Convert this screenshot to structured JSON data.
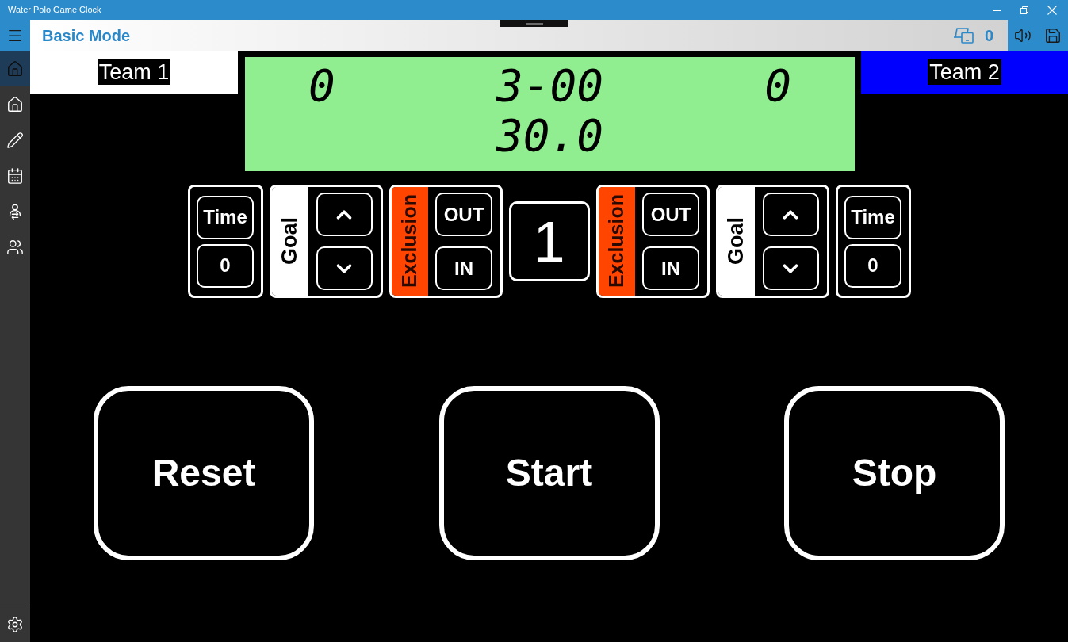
{
  "window": {
    "title": "Water Polo Game Clock"
  },
  "sidebar": {
    "items": [
      {
        "selected": true
      },
      {
        "selected": false
      },
      {
        "selected": false
      },
      {
        "selected": false
      },
      {
        "selected": false
      },
      {
        "selected": false
      }
    ]
  },
  "header": {
    "title": "Basic Mode",
    "device_count": "0"
  },
  "teams": [
    {
      "name": "Team 1",
      "color": "#ffffff"
    },
    {
      "name": "Team 2",
      "color": "#0000ff"
    }
  ],
  "scoreboard": {
    "home_score": "0",
    "game_time": "3-00",
    "away_score": "0",
    "shot_clock": "30.0"
  },
  "team_controls": [
    {
      "time_label": "Time",
      "timeouts": "0",
      "goal_label": "Goal",
      "exclusion_label": "Exclusion",
      "out_label": "OUT",
      "in_label": "IN"
    },
    {
      "time_label": "Time",
      "timeouts": "0",
      "goal_label": "Goal",
      "exclusion_label": "Exclusion",
      "out_label": "OUT",
      "in_label": "IN"
    }
  ],
  "period": "1",
  "buttons": [
    "Reset",
    "Start",
    "Stop"
  ]
}
